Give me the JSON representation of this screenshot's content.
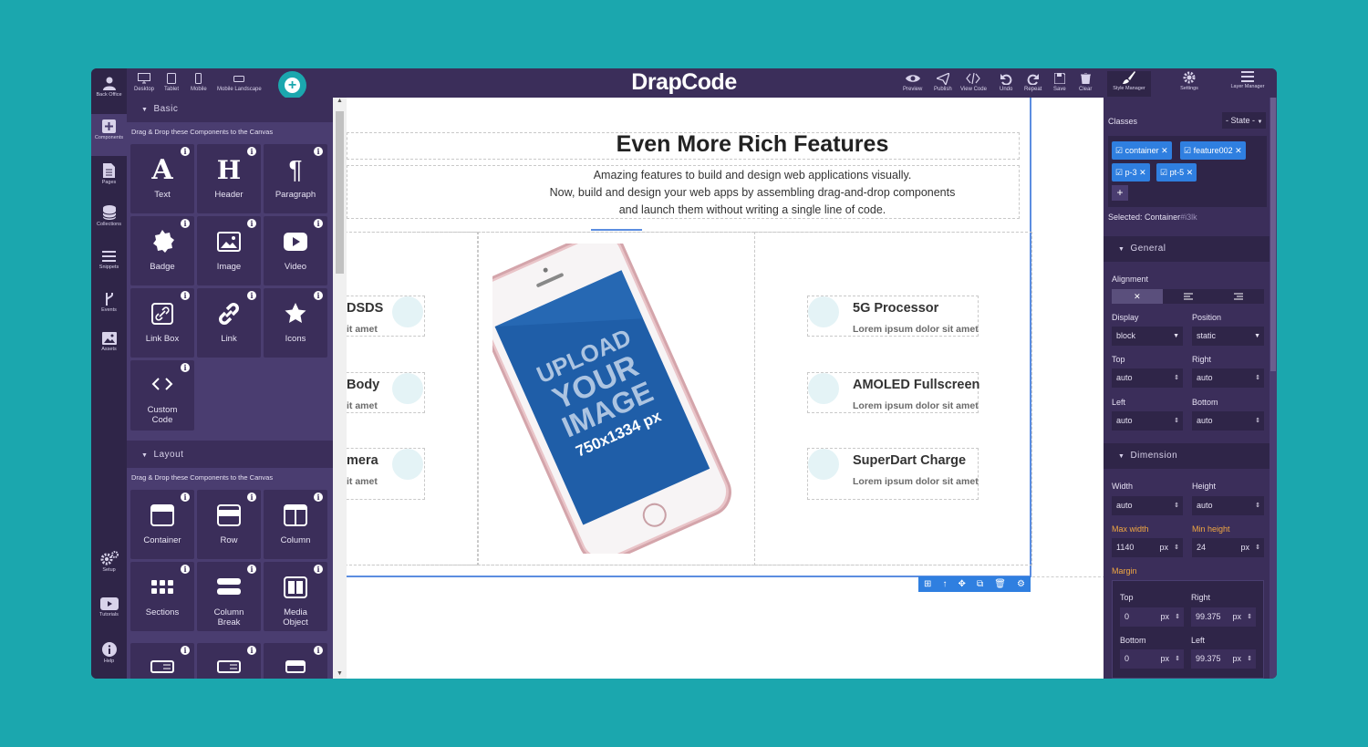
{
  "app": {
    "brand": "DrapCode"
  },
  "devices": [
    {
      "label": "Desktop",
      "icon": "desktop-icon"
    },
    {
      "label": "Tablet",
      "icon": "tablet-icon"
    },
    {
      "label": "Mobile",
      "icon": "mobile-icon"
    },
    {
      "label": "Mobile Landscape",
      "icon": "mobile-landscape-icon"
    }
  ],
  "toolbar": {
    "preview": "Preview",
    "publish": "Publish",
    "view_code": "View Code",
    "undo": "Undo",
    "repeat": "Repeat",
    "save": "Save",
    "clear": "Clear",
    "style_manager": "Style Manager",
    "settings": "Settings",
    "layer_manager": "Layer Manager"
  },
  "rail": {
    "back_office": "Back Office",
    "components": "Components",
    "pages": "Pages",
    "collections": "Collections",
    "snippets": "Snippets",
    "events": "Events",
    "assets": "Assets",
    "setup": "Setup",
    "tutorials": "Tutorials",
    "help": "Help"
  },
  "panel": {
    "basic": {
      "title": "Basic",
      "note": "Drag & Drop these Components to the Canvas",
      "items": [
        "Text",
        "Header",
        "Paragraph",
        "Badge",
        "Image",
        "Video",
        "Link Box",
        "Link",
        "Icons",
        "Custom Code"
      ]
    },
    "layout": {
      "title": "Layout",
      "note": "Drag & Drop these Components to the Canvas",
      "items": [
        "Container",
        "Row",
        "Column",
        "Sections",
        "Column Break",
        "Media Object"
      ]
    },
    "info_glyph": "i"
  },
  "canvas": {
    "title": "Even More Rich Features",
    "subtitle_lines": [
      "Amazing features to build and design web applications visually.",
      "Now, build and design your web apps by assembling drag-and-drop components",
      "and launch them without writing a single line of code."
    ],
    "left_features": [
      {
        "title": "DSDS",
        "desc": "it amet"
      },
      {
        "title": "Body",
        "desc": "it amet"
      },
      {
        "title": "mera",
        "desc": "it amet"
      }
    ],
    "right_features": [
      {
        "title": "5G Processor",
        "desc": "Lorem ipsum dolor sit amet"
      },
      {
        "title": "AMOLED Fullscreen",
        "desc": "Lorem ipsum dolor sit amet"
      },
      {
        "title": "SuperDart Charge",
        "desc": "Lorem ipsum dolor sit amet"
      }
    ],
    "phone_screen": [
      "UPLOAD",
      "YOUR",
      "IMAGE",
      "750x1334 px"
    ]
  },
  "style": {
    "classes_label": "Classes",
    "state_label": "- State -",
    "classes": [
      "container",
      "feature002",
      "p-3",
      "pt-5"
    ],
    "add_class": "+",
    "selected_label": "Selected:",
    "selected_value": "Container",
    "selected_id": "#i3lk",
    "general": {
      "title": "General",
      "alignment_label": "Alignment",
      "display_label": "Display",
      "display_value": "block",
      "position_label": "Position",
      "position_value": "static",
      "top_label": "Top",
      "top_value": "auto",
      "right_label": "Right",
      "right_value": "auto",
      "left_label": "Left",
      "left_value": "auto",
      "bottom_label": "Bottom",
      "bottom_value": "auto"
    },
    "dimension": {
      "title": "Dimension",
      "width_label": "Width",
      "width_value": "auto",
      "height_label": "Height",
      "height_value": "auto",
      "maxwidth_label": "Max width",
      "maxwidth_value": "1140",
      "maxwidth_unit": "px",
      "minheight_label": "Min height",
      "minheight_value": "24",
      "minheight_unit": "px",
      "margin_label": "Margin",
      "m_top_label": "Top",
      "m_top_value": "0",
      "m_top_unit": "px",
      "m_right_label": "Right",
      "m_right_value": "99.375",
      "m_right_unit": "px",
      "m_bottom_label": "Bottom",
      "m_bottom_value": "0",
      "m_bottom_unit": "px",
      "m_left_label": "Left",
      "m_left_value": "99.375",
      "m_left_unit": "px"
    }
  },
  "colors": {
    "accent": "#2f7fe0",
    "brand_teal": "#1ba7ae",
    "panel": "#3b2e5a",
    "highlight": "#f0a742"
  }
}
